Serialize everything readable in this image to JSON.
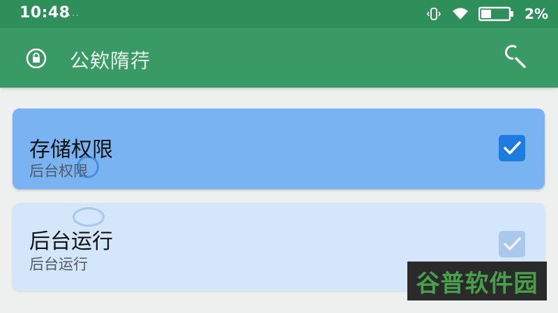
{
  "status_bar": {
    "time": "10:48",
    "dots": "....",
    "battery_percent": "2%"
  },
  "app_bar": {
    "title": "公欸隋荇",
    "icons": {
      "app": "lock-circle-icon",
      "search": "search-icon"
    }
  },
  "permissions": [
    {
      "title": "存储权限",
      "subtitle": "后台权限",
      "checked": true
    },
    {
      "title": "后台运行",
      "subtitle": "后台运行",
      "checked": true
    }
  ],
  "watermark": {
    "text": "谷普软件园"
  },
  "colors": {
    "status_bar": "#2f8f5b",
    "app_bar": "#3a9a66",
    "card_selected": "#79b3f1",
    "card_unselected": "#d4e6f9",
    "checkbox_active": "#1e7be0",
    "watermark_text": "#48a04a"
  }
}
